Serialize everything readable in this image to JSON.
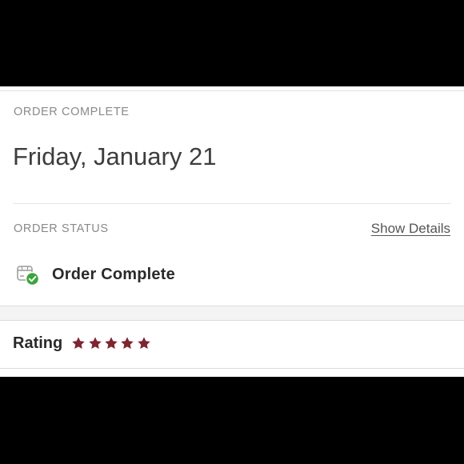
{
  "order": {
    "complete_heading": "ORDER COMPLETE",
    "date": "Friday, January 21"
  },
  "status": {
    "heading": "ORDER STATUS",
    "show_details_label": "Show Details",
    "text": "Order Complete",
    "icon": "box-checkmark-icon"
  },
  "rating": {
    "label": "Rating",
    "stars_filled": 5,
    "stars_total": 5,
    "star_color": "#7d2532"
  },
  "colors": {
    "success_green": "#3aa53a",
    "star": "#7d2532"
  }
}
